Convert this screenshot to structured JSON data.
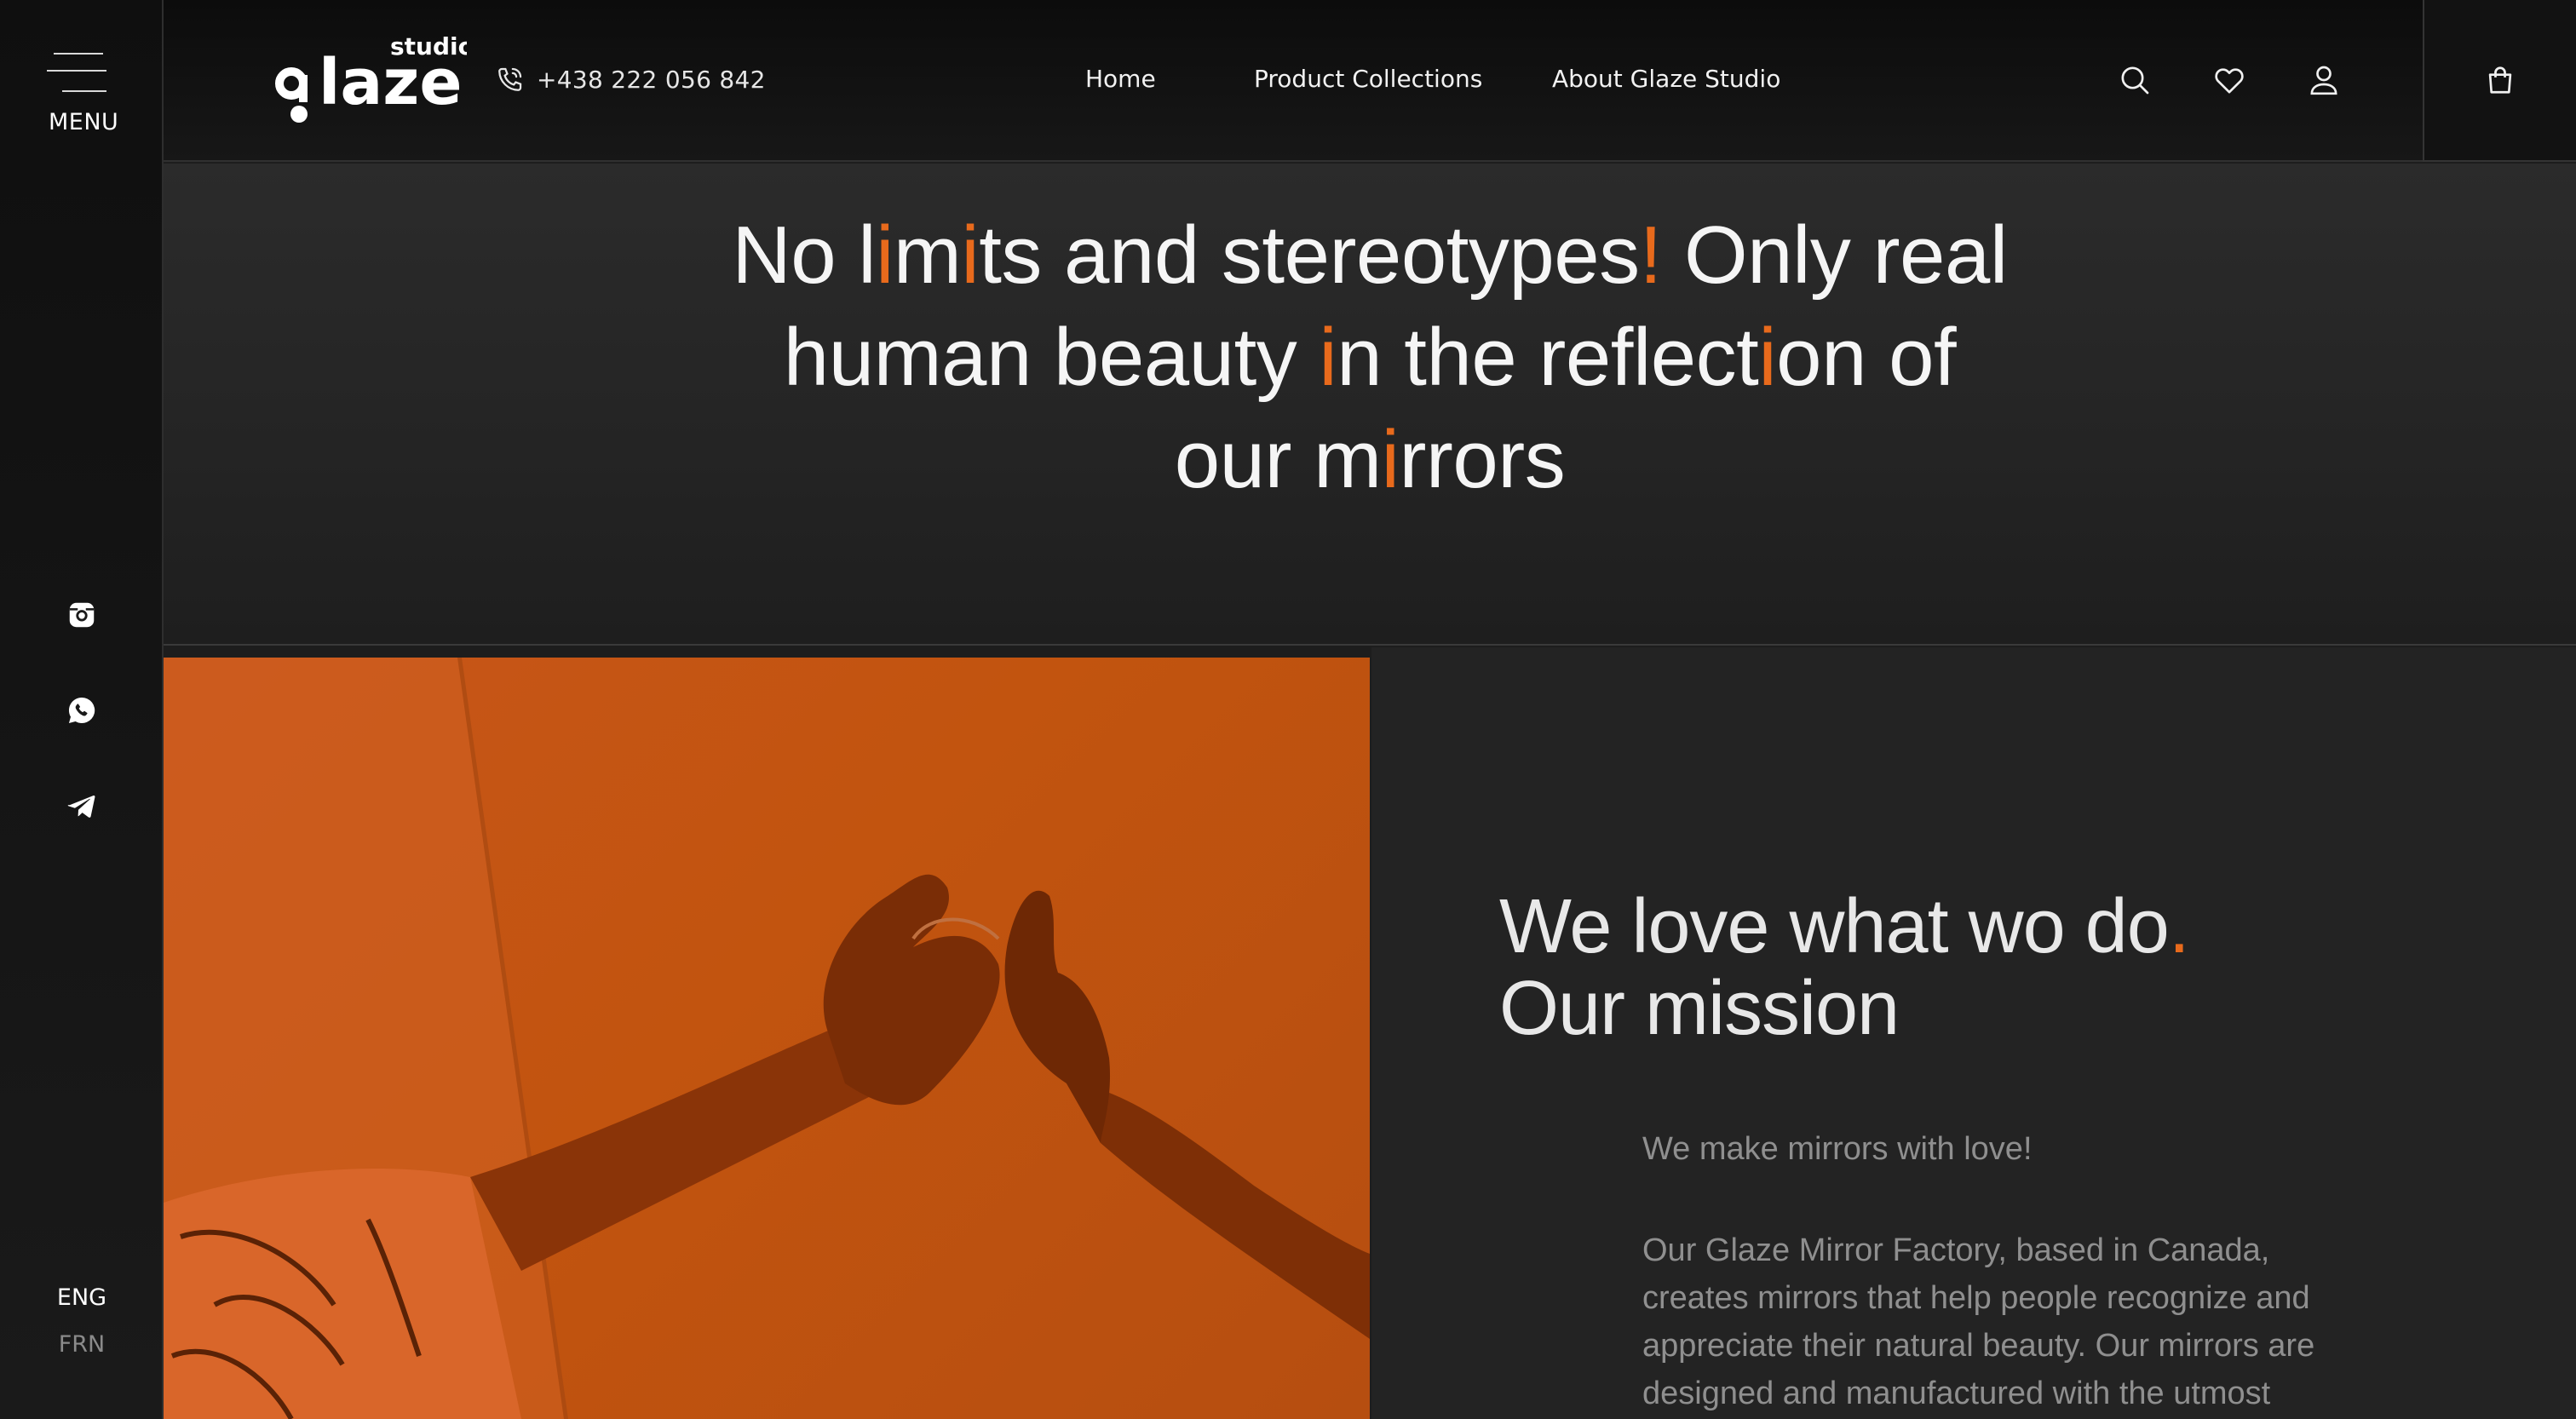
{
  "sidebar": {
    "menu_label": "MENU",
    "social": [
      "instagram-icon",
      "whatsapp-icon",
      "telegram-icon"
    ],
    "languages": [
      {
        "label": "ENG",
        "active": true
      },
      {
        "label": "FRN",
        "active": false
      }
    ]
  },
  "header": {
    "logo_text": "glaze",
    "logo_subtext": "studio",
    "phone": "+438 222 056 842",
    "nav": [
      "Home",
      "Product Collections",
      "About Glaze Studio"
    ],
    "icons": [
      "search-icon",
      "heart-icon",
      "user-icon",
      "shopping-bag-icon"
    ]
  },
  "hero": {
    "lines": [
      [
        {
          "t": "No l"
        },
        {
          "t": "i",
          "acc": true
        },
        {
          "t": "m"
        },
        {
          "t": "i",
          "acc": true
        },
        {
          "t": "ts and stereotypes"
        },
        {
          "t": "!",
          "acc": true
        },
        {
          "t": " Only real"
        }
      ],
      [
        {
          "t": "human beauty "
        },
        {
          "t": "i",
          "acc": true
        },
        {
          "t": "n the reflect"
        },
        {
          "t": "i",
          "acc": true
        },
        {
          "t": "on of"
        }
      ],
      [
        {
          "t": "our m"
        },
        {
          "t": "i",
          "acc": true
        },
        {
          "t": "rrors"
        }
      ]
    ]
  },
  "mission": {
    "title_line1": "We love what wo do",
    "title_dot": ".",
    "title_line2": "Our mission",
    "intro": "We make mirrors with love!",
    "body": "Our Glaze Mirror Factory, based in Canada, creates mirrors that help people recognize and appreciate their natural beauty. Our mirrors are designed and manufactured with the utmost attention to detail,"
  },
  "colors": {
    "accent": "#e86a1c",
    "background": "#1d1d1d",
    "photo_tint": "#c2540f"
  }
}
